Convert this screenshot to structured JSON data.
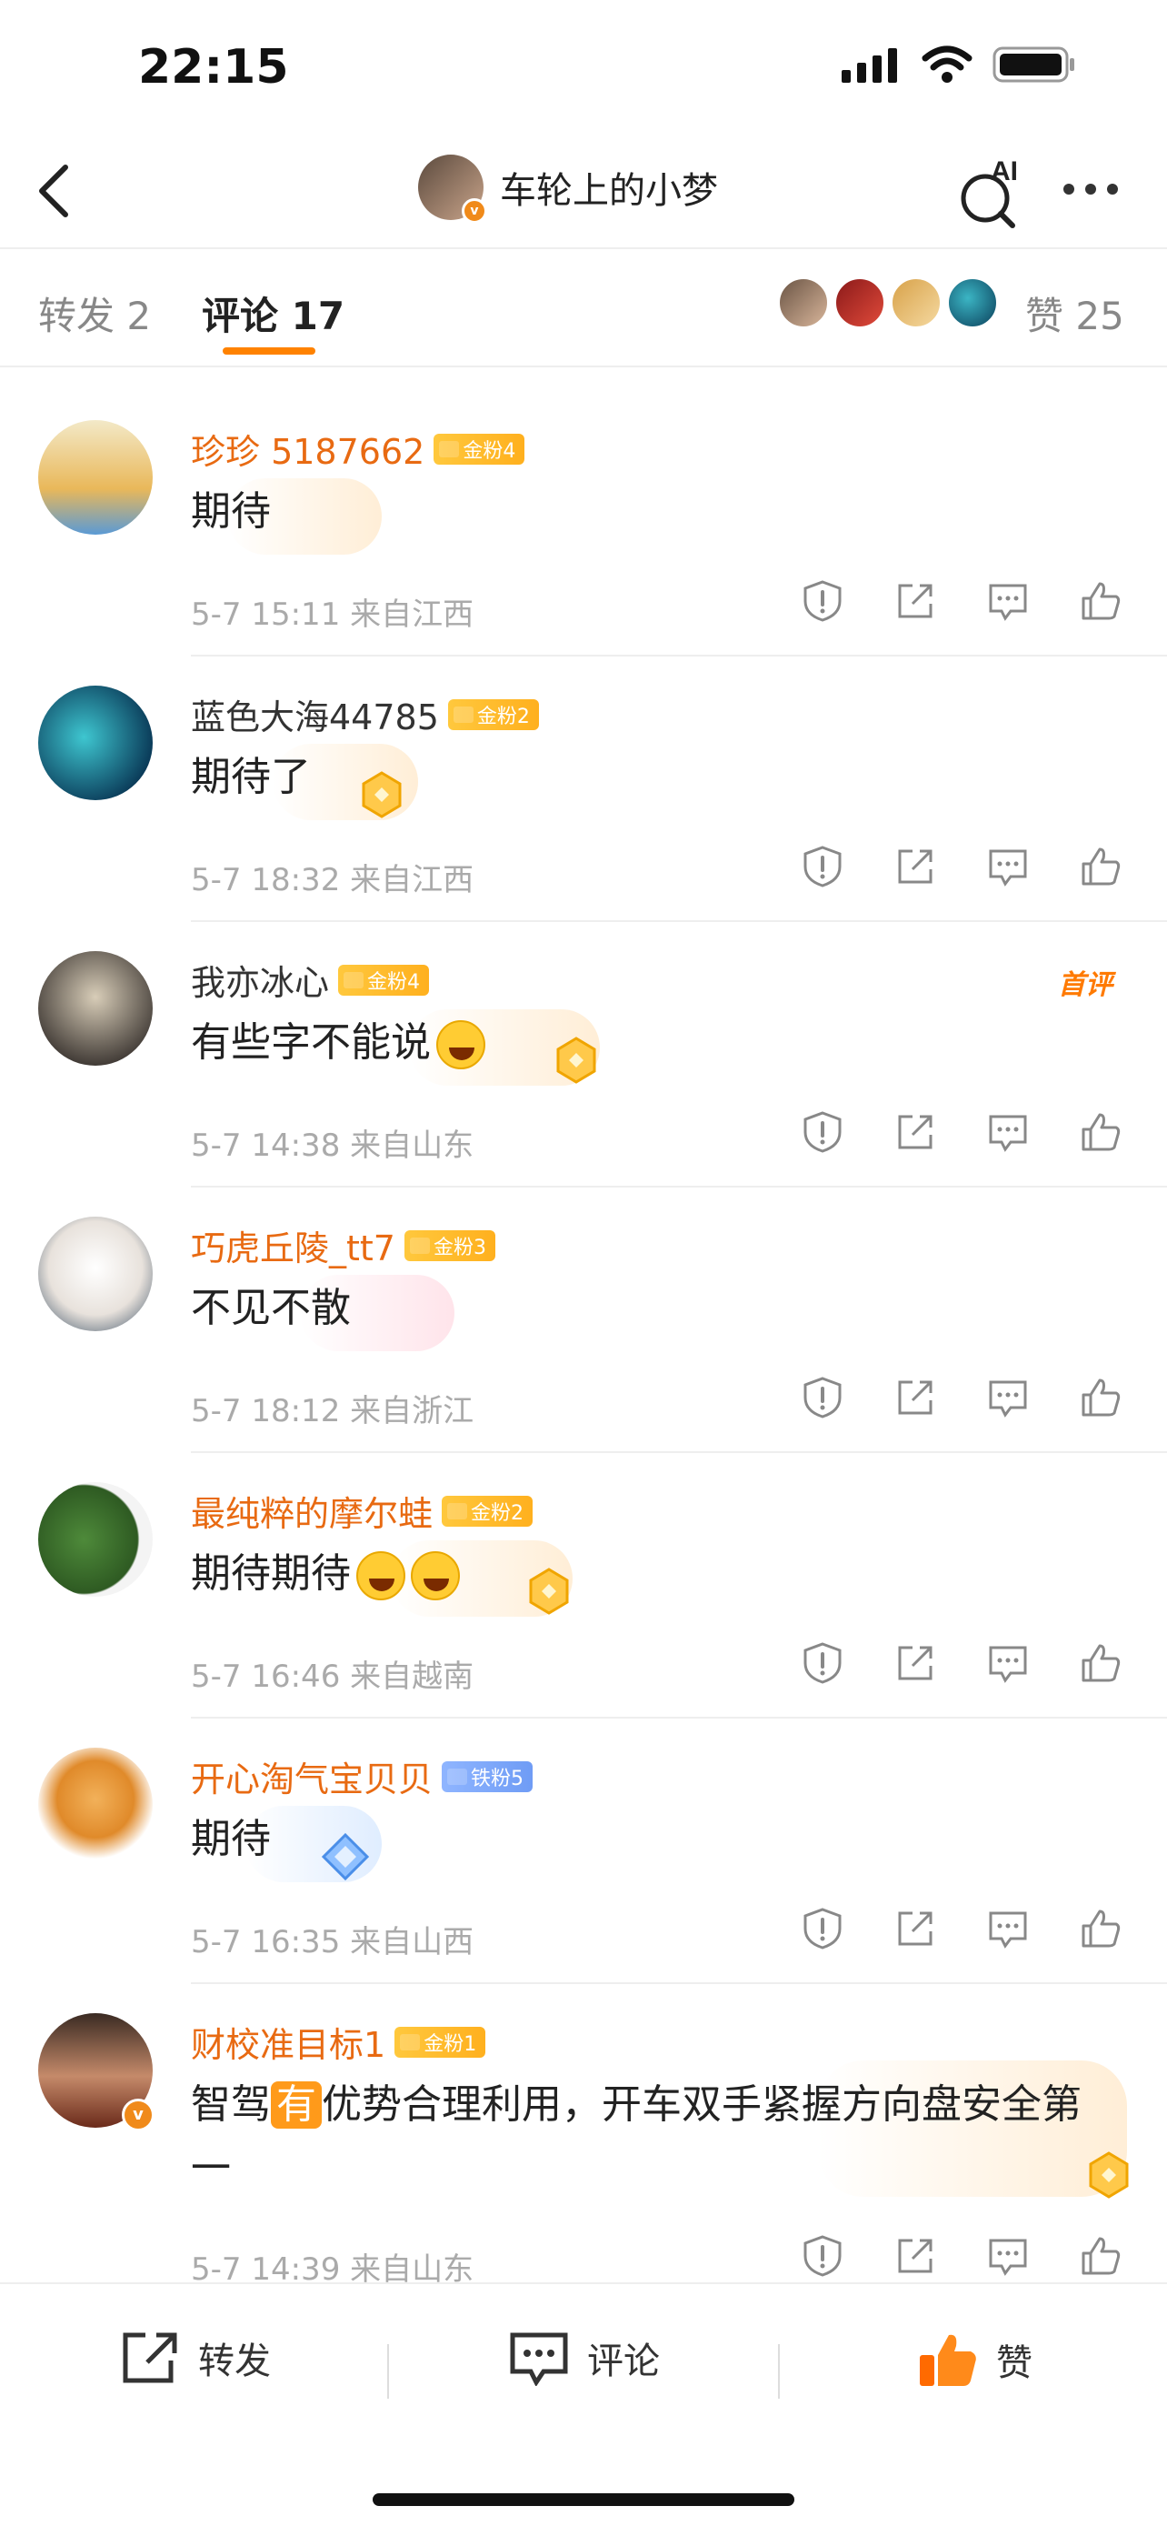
{
  "status_bar": {
    "time": "22:15"
  },
  "header": {
    "author_name": "车轮上的小梦",
    "ai_label": "AI"
  },
  "tabs": {
    "repost": "转发 2",
    "comment": "评论 17",
    "likes_label": "赞 25"
  },
  "comments": [
    {
      "username": "珍珍 5187662",
      "vip": true,
      "badge": "金粉4",
      "badge_type": "gold",
      "text": "期待",
      "time": "5-7 15:11",
      "location": "来自江西",
      "first": false,
      "tag_label": ""
    },
    {
      "username": "蓝色大海44785",
      "vip": false,
      "badge": "金粉2",
      "badge_type": "gold",
      "text": "期待了",
      "time": "5-7 18:32",
      "location": "来自江西",
      "first": false,
      "tag_label": ""
    },
    {
      "username": "我亦冰心",
      "vip": false,
      "badge": "金粉4",
      "badge_type": "gold",
      "text": "有些字不能说",
      "time": "5-7 14:38",
      "location": "来自山东",
      "first": true,
      "tag_label": "首评"
    },
    {
      "username": "巧虎丘陵_tt7",
      "vip": true,
      "badge": "金粉3",
      "badge_type": "gold",
      "text": "不见不散",
      "time": "5-7 18:12",
      "location": "来自浙江",
      "first": false,
      "tag_label": ""
    },
    {
      "username": "最纯粹的摩尔蛙",
      "vip": true,
      "badge": "金粉2",
      "badge_type": "gold",
      "text": "期待期待",
      "time": "5-7 16:46",
      "location": "来自越南",
      "first": false,
      "tag_label": ""
    },
    {
      "username": "开心淘气宝贝贝",
      "vip": true,
      "badge": "铁粉5",
      "badge_type": "iron",
      "text": "期待",
      "time": "5-7 16:35",
      "location": "来自山西",
      "first": false,
      "tag_label": ""
    },
    {
      "username": "财校准目标1",
      "vip": true,
      "badge": "金粉1",
      "badge_type": "gold",
      "text_pre": "智驾",
      "text_highlight": "有",
      "text_post": "优势合理利用，开车双手紧握方向盘安全第一",
      "time": "5-7 14:39",
      "location": "来自山东",
      "first": false,
      "tag_label": ""
    }
  ],
  "bottom_bar": {
    "repost": "转发",
    "comment": "评论",
    "like": "赞"
  },
  "colors": {
    "accent": "#ff8200",
    "vip_name": "#e86a12",
    "gold_badge": "#ffb01e",
    "iron_badge": "#6f9cf5"
  }
}
